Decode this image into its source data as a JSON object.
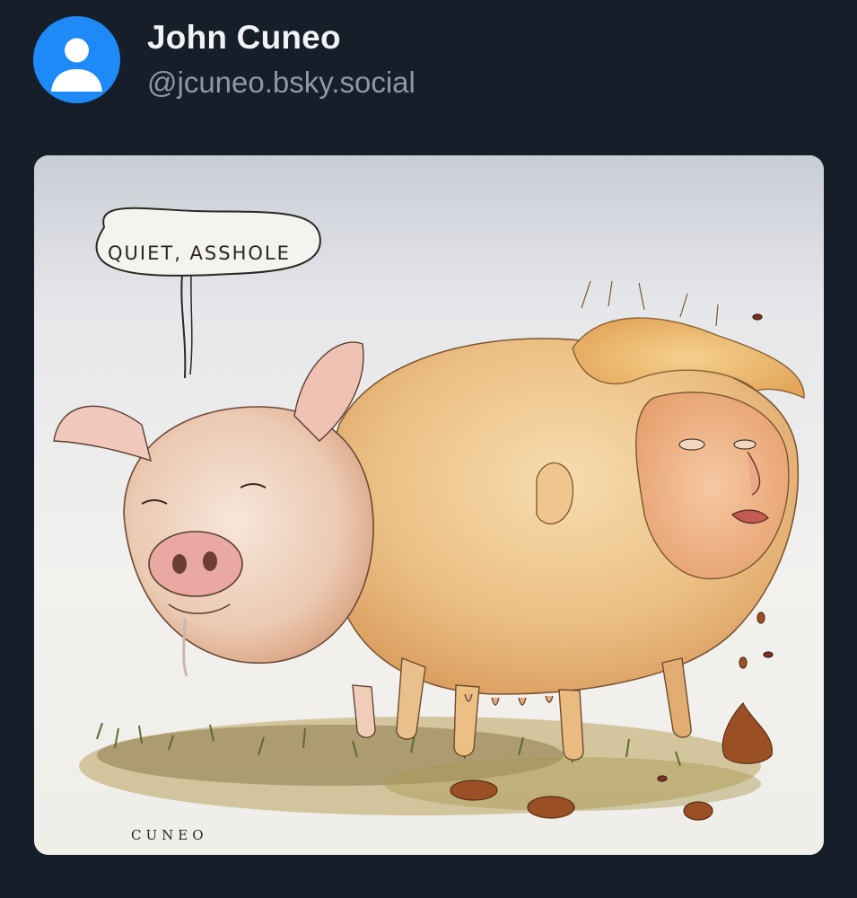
{
  "post": {
    "author": {
      "display_name": "John Cuneo",
      "handle": "@jcuneo.bsky.social",
      "avatar_icon": "default-user-avatar-icon",
      "avatar_color": "#1d8af7"
    },
    "image": {
      "speech_bubble_text": "QUIET, ASSHOLE",
      "signature": "CUNEO"
    }
  },
  "theme": {
    "background": "#161e2a",
    "name_color": "#f1f3f5",
    "handle_color": "#8b98a8"
  }
}
